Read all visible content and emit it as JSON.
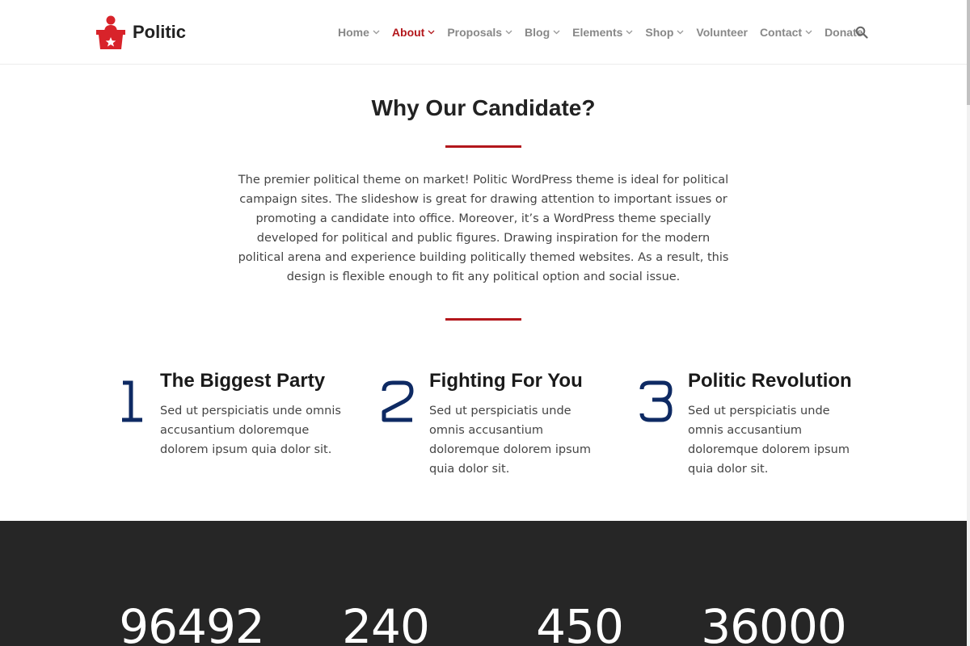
{
  "site": {
    "name": "Politic"
  },
  "nav": {
    "items": [
      {
        "label": "Home",
        "has_dropdown": true,
        "active": false
      },
      {
        "label": "About",
        "has_dropdown": true,
        "active": true
      },
      {
        "label": "Proposals",
        "has_dropdown": true,
        "active": false
      },
      {
        "label": "Blog",
        "has_dropdown": true,
        "active": false
      },
      {
        "label": "Elements",
        "has_dropdown": true,
        "active": false
      },
      {
        "label": "Shop",
        "has_dropdown": true,
        "active": false
      },
      {
        "label": "Volunteer",
        "has_dropdown": false,
        "active": false
      },
      {
        "label": "Contact",
        "has_dropdown": true,
        "active": false
      },
      {
        "label": "Donate",
        "has_dropdown": false,
        "active": false
      }
    ],
    "search_icon": "search-icon"
  },
  "intro": {
    "title": "Why Our Candidate?",
    "text": "The premier political theme on market! Politic WordPress theme is ideal for political campaign sites. The slideshow is great for drawing attention to important issues or promoting a candidate into office. Moreover, it’s a WordPress theme specially developed for political and public figures. Drawing inspiration for the modern political arena and experience building politically themed websites. As a result, this design is flexible enough to fit any political option and social issue."
  },
  "features": [
    {
      "number": "1",
      "title": "The Biggest Party",
      "text": "Sed ut perspiciatis unde omnis accusantium doloremque dolorem ipsum quia dolor sit."
    },
    {
      "number": "2",
      "title": "Fighting For You",
      "text": "Sed ut perspiciatis unde omnis accusantium doloremque dolorem ipsum quia dolor sit."
    },
    {
      "number": "3",
      "title": "Politic Revolution",
      "text": "Sed ut perspiciatis unde omnis accusantium doloremque dolorem ipsum quia dolor sit."
    }
  ],
  "stats": [
    {
      "value": "96492"
    },
    {
      "value": "240"
    },
    {
      "value": "450"
    },
    {
      "value": "36000"
    }
  ],
  "colors": {
    "accent": "#b3171c",
    "number_blue": "#0e2a63",
    "nav_text": "#888888",
    "dark_band": "#262626"
  }
}
